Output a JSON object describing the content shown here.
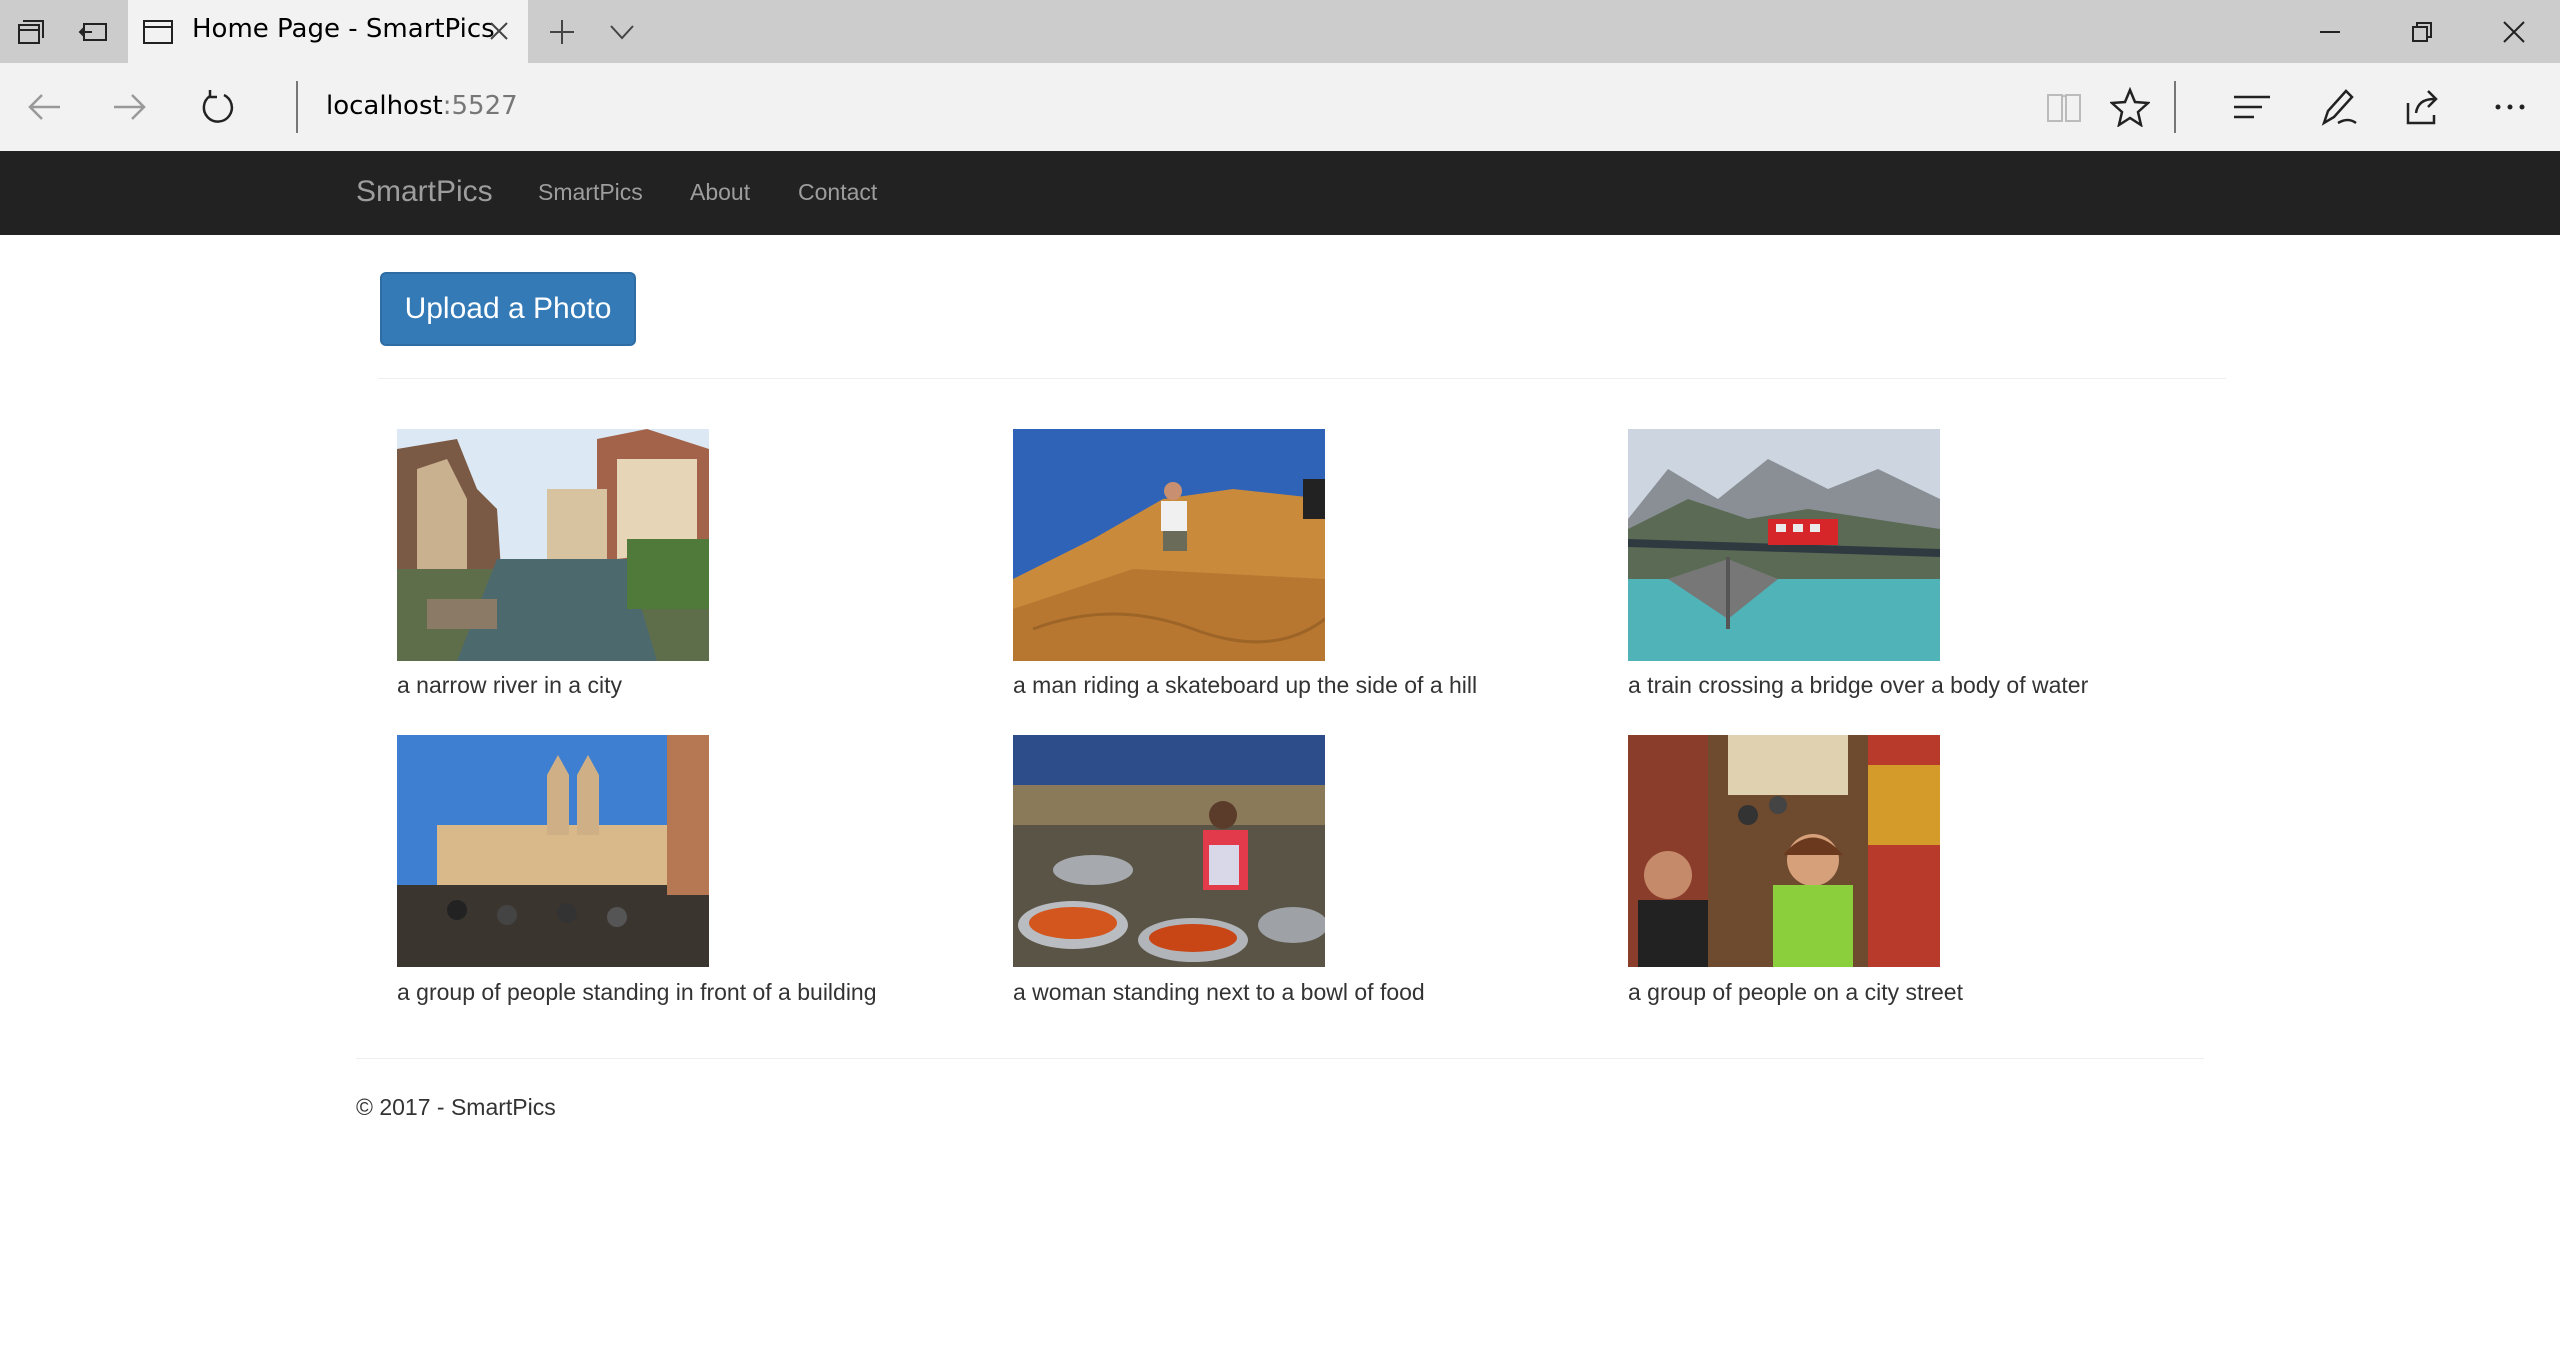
{
  "browser": {
    "tab_title": "Home Page - SmartPics",
    "address_host": "localhost",
    "address_port": ":5527"
  },
  "navbar": {
    "brand": "SmartPics",
    "links": [
      "SmartPics",
      "About",
      "Contact"
    ]
  },
  "main": {
    "upload_button": "Upload a Photo",
    "photos": [
      {
        "caption": "a narrow river in a city"
      },
      {
        "caption": "a man riding a skateboard up the side of a hill"
      },
      {
        "caption": "a train crossing a bridge over a body of water"
      },
      {
        "caption": "a group of people standing in front of a building"
      },
      {
        "caption": "a woman standing next to a bowl of food"
      },
      {
        "caption": "a group of people on a city street"
      }
    ]
  },
  "footer": {
    "text": "© 2017 - SmartPics"
  },
  "colors": {
    "navbar_bg": "#222222",
    "primary_button": "#337ab7"
  }
}
